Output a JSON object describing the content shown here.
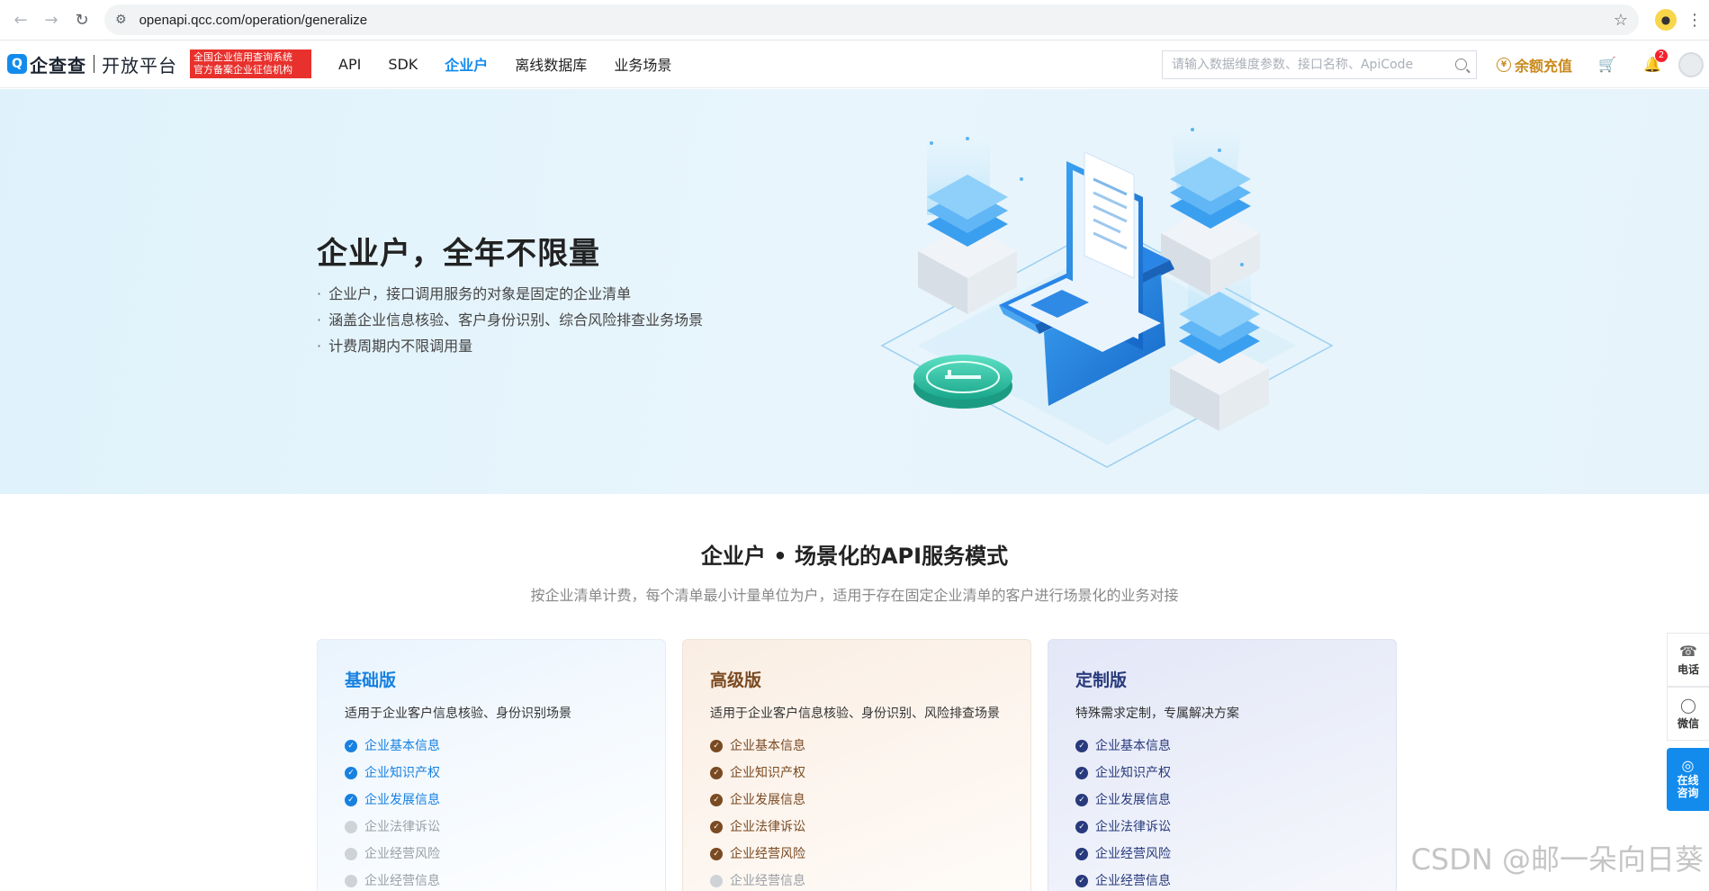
{
  "browser": {
    "url": "openapi.qcc.com/operation/generalize"
  },
  "header": {
    "logo_text": "企查查",
    "logo_sub": "开放平台",
    "badge_line1": "全国企业信用查询系统",
    "badge_line2": "官方备案企业征信机构",
    "nav": [
      {
        "label": "API",
        "active": false
      },
      {
        "label": "SDK",
        "active": false
      },
      {
        "label": "企业户",
        "active": true
      },
      {
        "label": "离线数据库",
        "active": false
      },
      {
        "label": "业务场景",
        "active": false
      }
    ],
    "search_placeholder": "请输入数据维度参数、接口名称、ApiCode",
    "recharge_label": "余额充值",
    "notification_count": "2"
  },
  "hero": {
    "title": "企业户，全年不限量",
    "bullets": [
      "企业户，接口调用服务的对象是固定的企业清单",
      "涵盖企业信息核验、客户身份识别、综合风险排查业务场景",
      "计费周期内不限调用量"
    ]
  },
  "section": {
    "title": "企业户 • 场景化的API服务模式",
    "subtitle": "按企业清单计费，每个清单最小计量单位为户，适用于存在固定企业清单的客户进行场景化的业务对接"
  },
  "plans": [
    {
      "name": "基础版",
      "desc": "适用于企业客户信息核验、身份识别场景",
      "features": [
        {
          "label": "企业基本信息",
          "included": true
        },
        {
          "label": "企业知识产权",
          "included": true
        },
        {
          "label": "企业发展信息",
          "included": true
        },
        {
          "label": "企业法律诉讼",
          "included": false
        },
        {
          "label": "企业经营风险",
          "included": false
        },
        {
          "label": "企业经营信息",
          "included": false
        }
      ]
    },
    {
      "name": "高级版",
      "desc": "适用于企业客户信息核验、身份识别、风险排查场景",
      "features": [
        {
          "label": "企业基本信息",
          "included": true
        },
        {
          "label": "企业知识产权",
          "included": true
        },
        {
          "label": "企业发展信息",
          "included": true
        },
        {
          "label": "企业法律诉讼",
          "included": true
        },
        {
          "label": "企业经营风险",
          "included": true
        },
        {
          "label": "企业经营信息",
          "included": false
        }
      ]
    },
    {
      "name": "定制版",
      "desc": "特殊需求定制，专属解决方案",
      "features": [
        {
          "label": "企业基本信息",
          "included": true
        },
        {
          "label": "企业知识产权",
          "included": true
        },
        {
          "label": "企业发展信息",
          "included": true
        },
        {
          "label": "企业法律诉讼",
          "included": true
        },
        {
          "label": "企业经营风险",
          "included": true
        },
        {
          "label": "企业经营信息",
          "included": true
        }
      ]
    }
  ],
  "float_bar": {
    "phone": "电话",
    "wechat": "微信",
    "consult_line1": "在线",
    "consult_line2": "咨询"
  },
  "watermark": "CSDN @邮一朵向日葵"
}
